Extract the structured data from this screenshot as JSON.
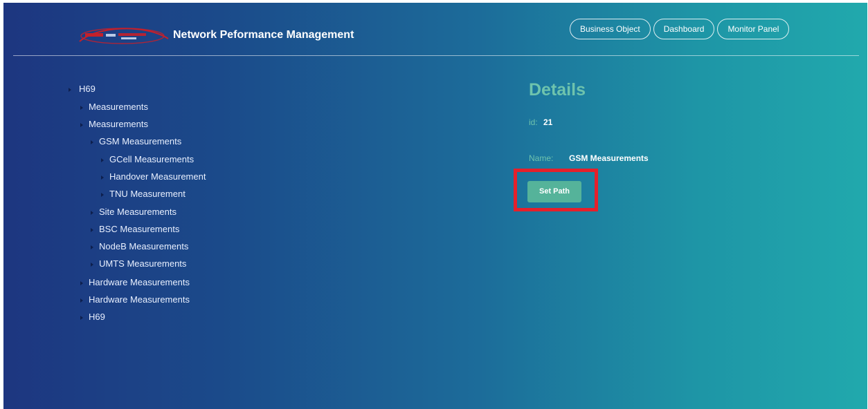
{
  "header": {
    "title": "Network Peformance Management",
    "nav": [
      {
        "label": "Business Object"
      },
      {
        "label": "Dashboard"
      },
      {
        "label": "Monitor Panel"
      }
    ]
  },
  "tree": [
    {
      "label": "H69"
    },
    {
      "label": "Measurements"
    },
    {
      "label": "Measurements"
    },
    {
      "label": "GSM Measurements"
    },
    {
      "label": "GCell Measurements"
    },
    {
      "label": "Handover Measurement"
    },
    {
      "label": "TNU Measurement"
    },
    {
      "label": "Site Measurements"
    },
    {
      "label": "BSC Measurements"
    },
    {
      "label": "NodeB Measurements"
    },
    {
      "label": "UMTS Measurements"
    },
    {
      "label": "Hardware Measurements"
    },
    {
      "label": "Hardware Measurements"
    },
    {
      "label": "H69"
    }
  ],
  "details": {
    "title": "Details",
    "id_label": "id:",
    "id_value": "21",
    "name_label": "Name:",
    "name_value": "GSM Measurements",
    "set_path_label": "Set Path"
  },
  "colors": {
    "accent": "#6ec3ad",
    "button": "#55b39a",
    "highlight": "#e5202b"
  }
}
